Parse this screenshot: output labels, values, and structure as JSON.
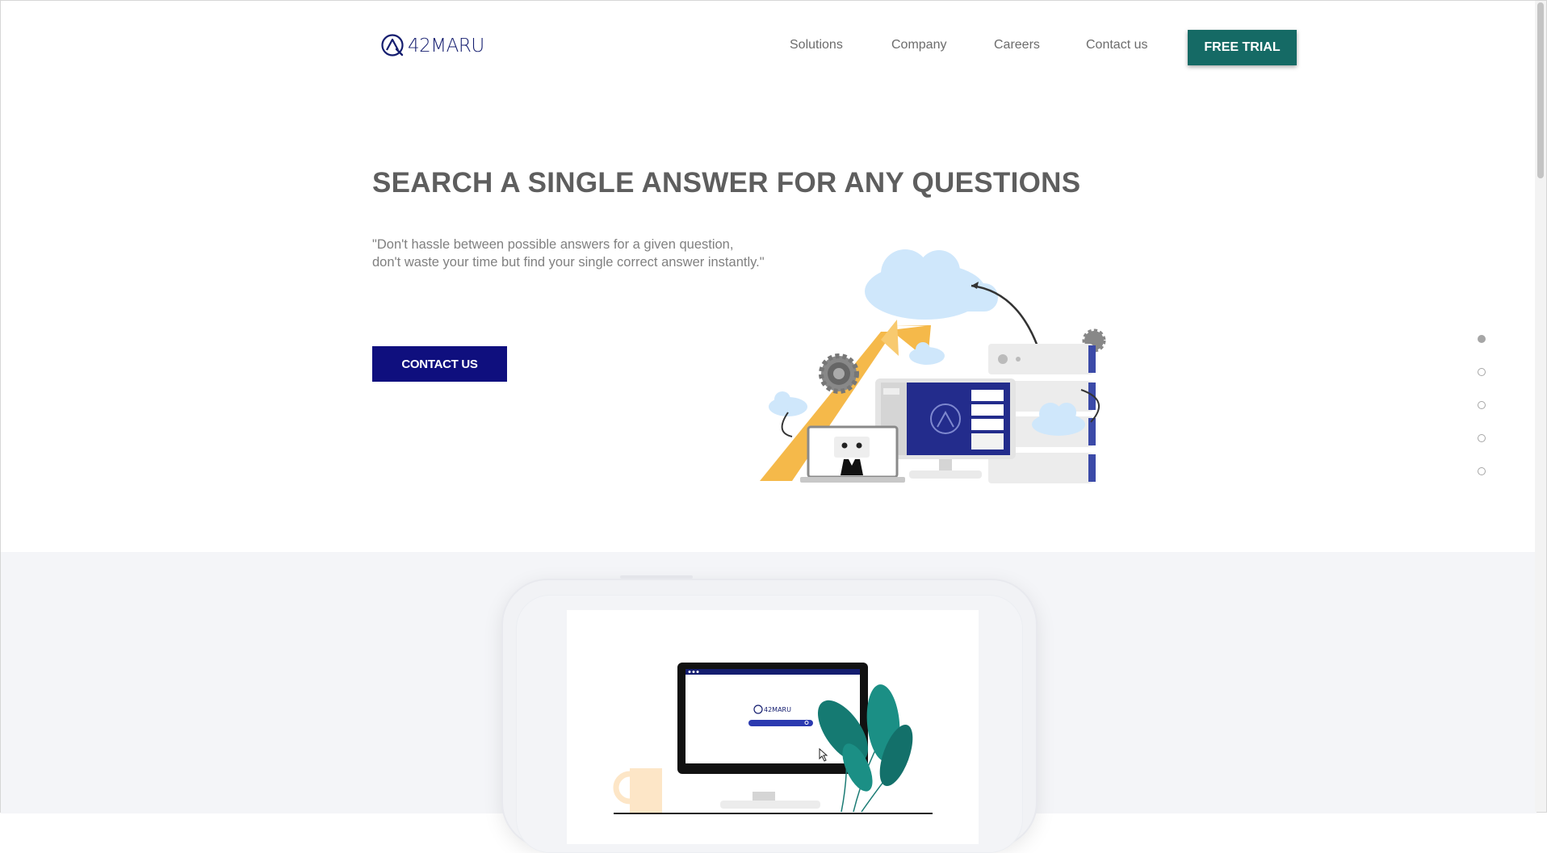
{
  "header": {
    "logo_text": "42MARU",
    "nav": [
      {
        "label": "Solutions"
      },
      {
        "label": "Company"
      },
      {
        "label": "Careers"
      },
      {
        "label": "Contact us"
      }
    ],
    "cta_label": "FREE TRIAL"
  },
  "hero": {
    "title": "SEARCH A SINGLE ANSWER FOR ANY QUESTIONS",
    "quote_line1": "\"Don't hassle between possible answers for a given question,",
    "quote_line2": "don't waste your time but find your single correct answer instantly.\"",
    "contact_label": "CONTACT US"
  },
  "pagination": {
    "count": 5,
    "active_index": 0
  },
  "demo": {
    "logo_text": "42MARU"
  },
  "colors": {
    "brand_navy": "#0f0f7e",
    "brand_teal": "#156a65",
    "illustration_orange": "#f5b94a",
    "illustration_cloud": "#cfe7fb"
  },
  "icons": [
    "logo-q-icon",
    "gear-icon",
    "cloud-icon",
    "robot-icon",
    "search-icon",
    "cursor-icon",
    "plant-icon",
    "mug-icon"
  ]
}
